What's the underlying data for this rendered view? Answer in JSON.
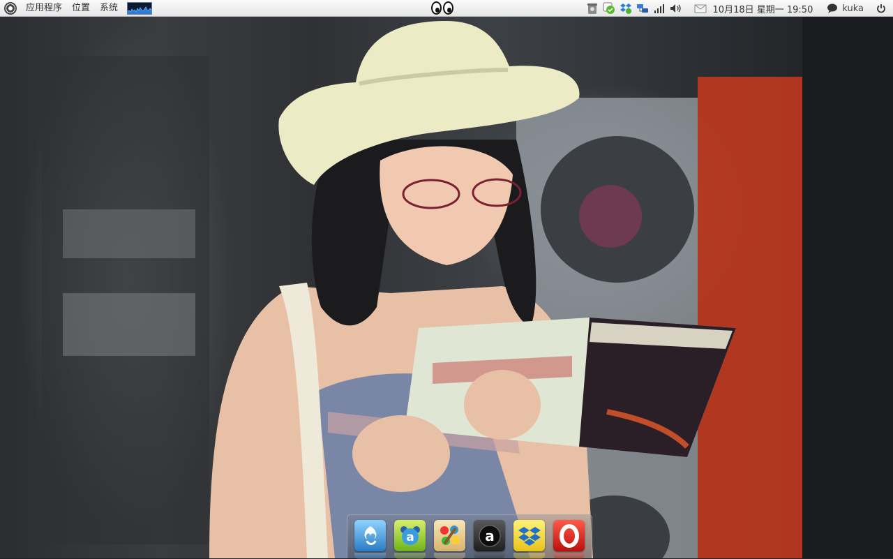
{
  "panel": {
    "menus": [
      "应用程序",
      "位置",
      "系统"
    ],
    "clock": "10月18日 星期一 19:50",
    "user": "kuka"
  },
  "tray": {
    "icons": [
      "trash-icon",
      "update-notifier-icon",
      "dropbox-icon",
      "network-manager-icon",
      "signal-strength-icon",
      "volume-icon",
      "mail-icon",
      "chat-status-icon",
      "power-icon"
    ]
  },
  "dock": {
    "apps": [
      "app-launcher-swirl",
      "app-ubuntu-software",
      "app-paint",
      "app-amazon-a",
      "app-dropbox",
      "app-opera"
    ]
  },
  "colors": {
    "panel": "#f0f0f0",
    "dock_border": "#c8d2dc"
  }
}
